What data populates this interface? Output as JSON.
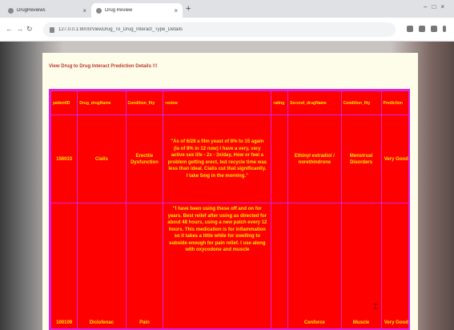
{
  "browser": {
    "tabs": [
      {
        "title": "DrugReviews",
        "active": false
      },
      {
        "title": "Drug Review",
        "active": true
      }
    ],
    "url": "127.0.0.1:8000/ViewDrug_To_Drug_Interact_Type_Details"
  },
  "page": {
    "heading": "View Drug to Drug Interact Prediction Details !!!"
  },
  "table": {
    "columns": [
      "patientID",
      "Drug_drugName",
      "Condition_fity",
      "review",
      "rating",
      "Second_drugName",
      "Condition_fity",
      "Prediction"
    ],
    "rows": [
      {
        "patient_id": "156033",
        "drug": "Cialis",
        "condition": "Erectile Dysfunction",
        "review": "\"As of 6/28 a film yeast of 8% to 15 again (la of 8% in 12 now) I have a very, very active sex life - 2x - 3x/day, How or feel a problem getting erect, but recycle time was less than ideal. Cialis cut that significantly. I take 5mg in the morning.\"",
        "rating": "",
        "second_drug": "Ethinyl estradiol / norethindrone",
        "second_condition": "Menstrual Disorders",
        "prediction": "Very Good"
      },
      {
        "patient_id": "100109",
        "drug": "Diclofenac",
        "condition": "Pain",
        "review": "\"I have been using these off and on for years. Best relief after using as directed for about 48 hours, using a new patch every 12 hours. This medication is for inflammation so it takes a little while for swelling to subside enough for pain relief. I use along with oxycodone and muscle",
        "rating": "",
        "second_drug": "Cenforce",
        "second_condition": "Muscle",
        "prediction": "Very Good"
      }
    ]
  },
  "colors": {
    "table_bg": "#ff0000",
    "table_text": "#ffe600",
    "table_border": "#e020e0",
    "heading": "#c0392b"
  }
}
